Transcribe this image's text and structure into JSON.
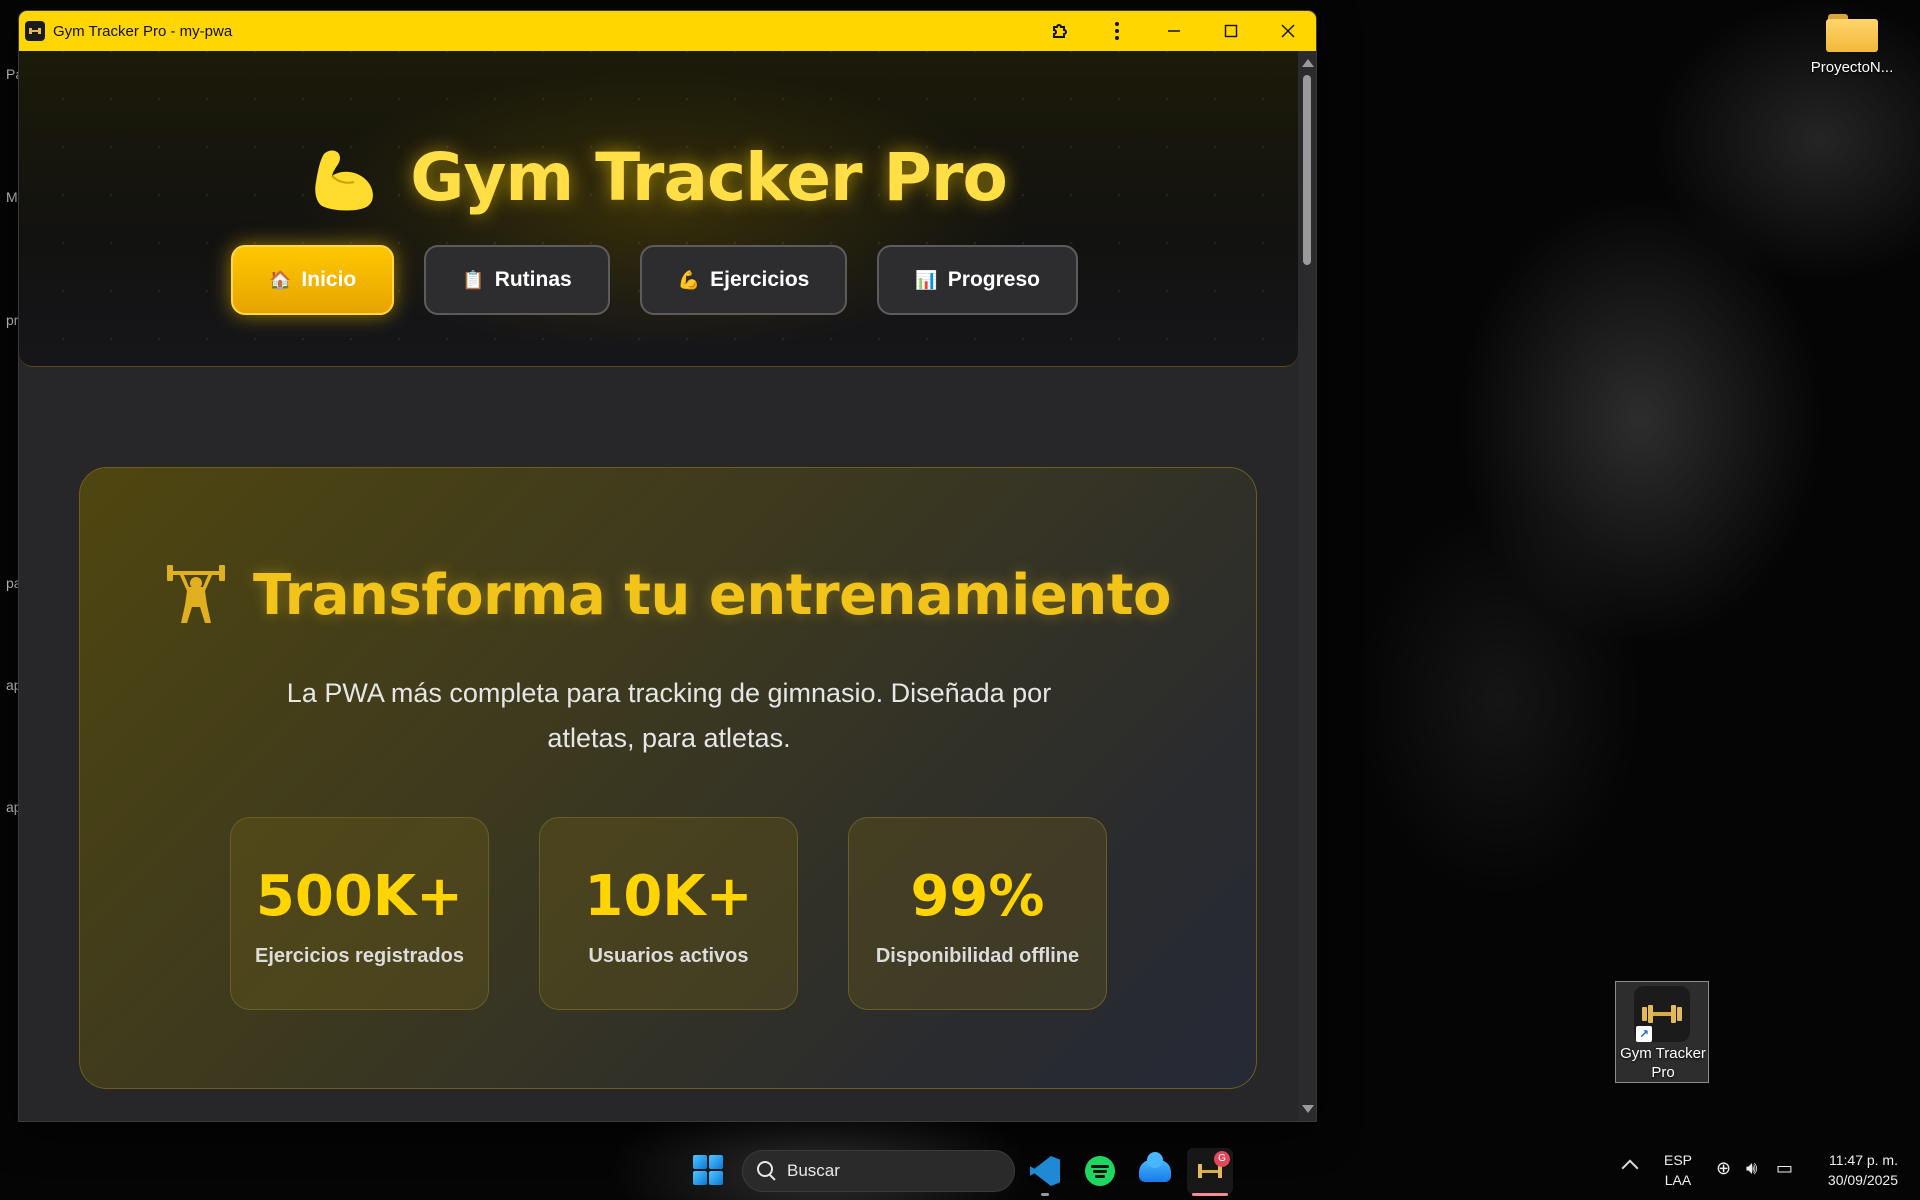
{
  "desktop": {
    "left_edge_labels": [
      "Pa",
      "M",
      "pr",
      "pa",
      "ap",
      "ap"
    ],
    "folder_icon": {
      "label": "ProyectoN..."
    },
    "shortcut": {
      "label_line1": "Gym Tracker",
      "label_line2": "Pro"
    }
  },
  "window": {
    "title": "Gym Tracker Pro - my-pwa",
    "controls": [
      "extensions-icon",
      "more-icon",
      "minimize-icon",
      "maximize-icon",
      "close-icon"
    ],
    "accent_color": "#ffd600"
  },
  "app": {
    "brand_title": "Gym Tracker Pro",
    "nav": [
      {
        "icon": "🏠",
        "label": "Inicio",
        "active": true
      },
      {
        "icon": "📋",
        "label": "Rutinas",
        "active": false
      },
      {
        "icon": "💪",
        "label": "Ejercicios",
        "active": false
      },
      {
        "icon": "📊",
        "label": "Progreso",
        "active": false
      }
    ],
    "hero_card": {
      "title": "Transforma tu entrenamiento",
      "description": "La PWA más completa para tracking de gimnasio. Diseñada por atletas, para atletas.",
      "stats": [
        {
          "value": "500K+",
          "label": "Ejercicios registrados"
        },
        {
          "value": "10K+",
          "label": "Usuarios activos"
        },
        {
          "value": "99%",
          "label": "Disponibilidad offline"
        }
      ]
    }
  },
  "taskbar": {
    "search_placeholder": "Buscar",
    "gym_badge": "G",
    "language_line1": "ESP",
    "language_line2": "LAA",
    "time": "11:47 p. m.",
    "date": "30/09/2025"
  }
}
